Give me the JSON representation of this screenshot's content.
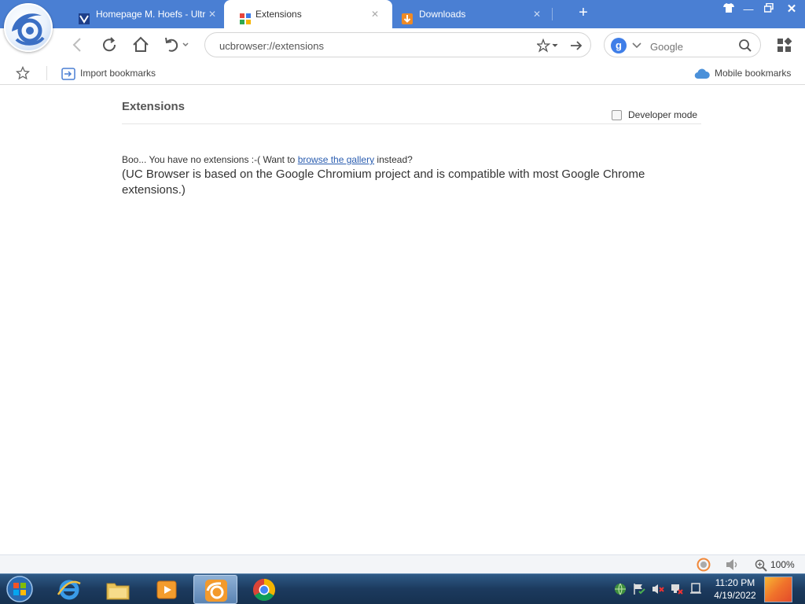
{
  "tabs": [
    {
      "label": "Homepage M. Hoefs - Ultr",
      "active": false
    },
    {
      "label": "Extensions",
      "active": true
    },
    {
      "label": "Downloads",
      "active": false
    }
  ],
  "address": {
    "value": "ucbrowser://extensions"
  },
  "search": {
    "engine": "g",
    "placeholder": "Google"
  },
  "bookmarks": {
    "import_label": "Import bookmarks",
    "mobile_label": "Mobile bookmarks"
  },
  "page": {
    "title": "Extensions",
    "developer_mode_label": "Developer mode",
    "developer_mode_checked": false,
    "empty_prefix": "Boo... You have no extensions :-( Want to ",
    "empty_link": "browse the gallery",
    "empty_suffix": " instead?",
    "compat_note": "(UC Browser is based on the Google Chromium project and is compatible with most Google Chrome extensions.)"
  },
  "status": {
    "zoom": "100%"
  },
  "taskbar": {
    "time": "11:20 PM",
    "date": "4/19/2022"
  },
  "colors": {
    "titlebar": "#4a7fd3",
    "link": "#2a5db0",
    "taskbar": "#1c3a5e"
  }
}
